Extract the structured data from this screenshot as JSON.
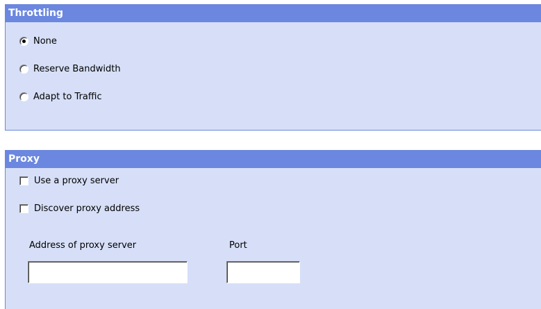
{
  "throttling": {
    "title": "Throttling",
    "options": [
      {
        "label": "None",
        "selected": true
      },
      {
        "label": "Reserve Bandwidth",
        "selected": false
      },
      {
        "label": "Adapt to Traffic",
        "selected": false
      }
    ]
  },
  "proxy": {
    "title": "Proxy",
    "use_proxy": {
      "label": "Use a proxy server",
      "checked": false
    },
    "discover": {
      "label": "Discover proxy address",
      "checked": false
    },
    "address": {
      "label": "Address of proxy server",
      "value": "",
      "placeholder": ""
    },
    "port": {
      "label": "Port",
      "value": "",
      "placeholder": ""
    }
  },
  "colors": {
    "header": "#6b87df",
    "panel": "#d6dff7"
  }
}
